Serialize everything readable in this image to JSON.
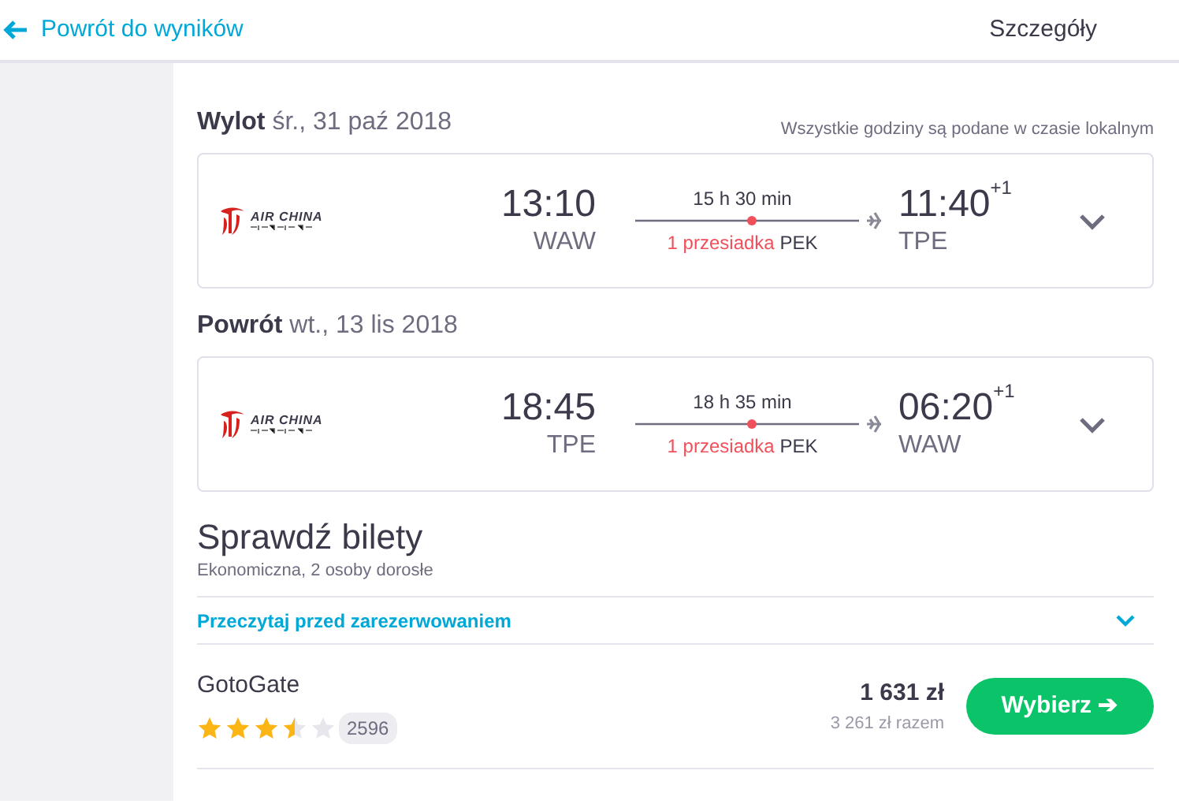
{
  "header": {
    "back_link": "Powrót do wyników",
    "title": "Szczegóły"
  },
  "legs": [
    {
      "label": "Wylot",
      "date": "śr., 31 paź 2018",
      "note": "Wszystkie godziny są podane w czasie lokalnym",
      "airline": "AIR CHINA",
      "depart_time": "13:10",
      "depart_airport": "WAW",
      "duration": "15 h 30 min",
      "stops": "1 przesiadka",
      "stop_airport": "PEK",
      "arrive_time": "11:40",
      "day_offset": "+1",
      "arrive_airport": "TPE",
      "expanded": false
    },
    {
      "label": "Powrót",
      "date": "wt., 13 lis 2018",
      "airline": "AIR CHINA",
      "depart_time": "18:45",
      "depart_airport": "TPE",
      "duration": "18 h 35 min",
      "stops": "1 przesiadka",
      "stop_airport": "PEK",
      "arrive_time": "06:20",
      "day_offset": "+1",
      "arrive_airport": "WAW",
      "expanded": false
    }
  ],
  "tickets": {
    "title": "Sprawdź bilety",
    "subtitle": "Ekonomiczna, 2 osoby dorosłe",
    "notice": {
      "label": "Przeczytaj przed zarezerwowaniem",
      "expanded": false
    },
    "offers": [
      {
        "provider": "GotoGate",
        "stars": 3.5,
        "reviews": "2596",
        "price": "1 631 zł",
        "total": "3 261 zł razem",
        "button": "Wybierz ➔"
      }
    ]
  }
}
